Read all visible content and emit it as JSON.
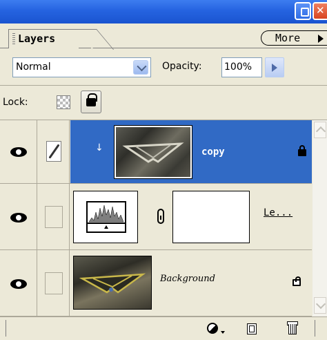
{
  "panel": {
    "tab_label": "Layers",
    "more_label": "More"
  },
  "blend": {
    "mode": "Normal",
    "opacity_label": "Opacity:",
    "opacity_value": "100%"
  },
  "lock": {
    "label": "Lock:"
  },
  "layers": [
    {
      "name": "copy",
      "selected": true,
      "visible": true,
      "locked": true,
      "clipped": true
    },
    {
      "name": "Le...",
      "selected": false,
      "visible": true,
      "locked": false,
      "type": "adjustment"
    },
    {
      "name": "Background",
      "selected": false,
      "visible": true,
      "locked": true
    }
  ],
  "colors": {
    "selection": "#316ac5",
    "panel_bg": "#ece9d8",
    "titlebar": "#2563e0"
  },
  "icons": [
    "eye-icon",
    "brush-icon",
    "lock-icon",
    "chain-link-icon",
    "adjustment-layer-icon",
    "new-layer-icon",
    "trash-icon"
  ]
}
